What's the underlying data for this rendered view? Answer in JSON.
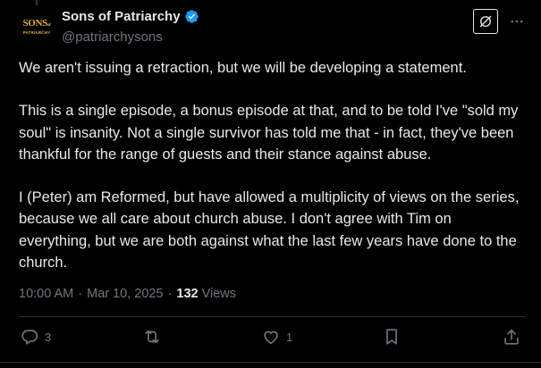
{
  "author": {
    "avatar_line1": "SONS",
    "avatar_line1_small": "of",
    "avatar_line2": "PATRIARCHY",
    "display_name": "Sons of Patriarchy",
    "handle": "@patriarchysons",
    "verified": true,
    "verified_color": "#1d9bf0"
  },
  "tweet": {
    "paragraphs": [
      "We aren't issuing a retraction, but we will be developing a statement.",
      "This is a single episode, a bonus episode at that, and to be told I've \"sold my soul\" is insanity. Not a single survivor has told me that - in fact, they've been thankful for the range of guests and their stance against abuse.",
      "I (Peter) am Reformed, but have allowed a multiplicity of views on the series, because we all care about church abuse. I don't agree with Tim on everything, but we are both against what the last few years have done to the church."
    ],
    "time": "10:00 AM",
    "date": "Mar 10, 2025",
    "views_count": "132",
    "views_label": "Views"
  },
  "actions": {
    "replies": "3",
    "reposts": "",
    "likes": "1"
  },
  "icons": {
    "grok": "grok-icon",
    "more": "more-icon",
    "reply": "reply-icon",
    "repost": "repost-icon",
    "like": "like-icon",
    "bookmark": "bookmark-icon",
    "share": "share-icon"
  },
  "colors": {
    "background": "#000000",
    "text": "#e7e9ea",
    "muted": "#71767b",
    "divider": "#2f3336",
    "avatar_gold": "#e4b33a"
  }
}
